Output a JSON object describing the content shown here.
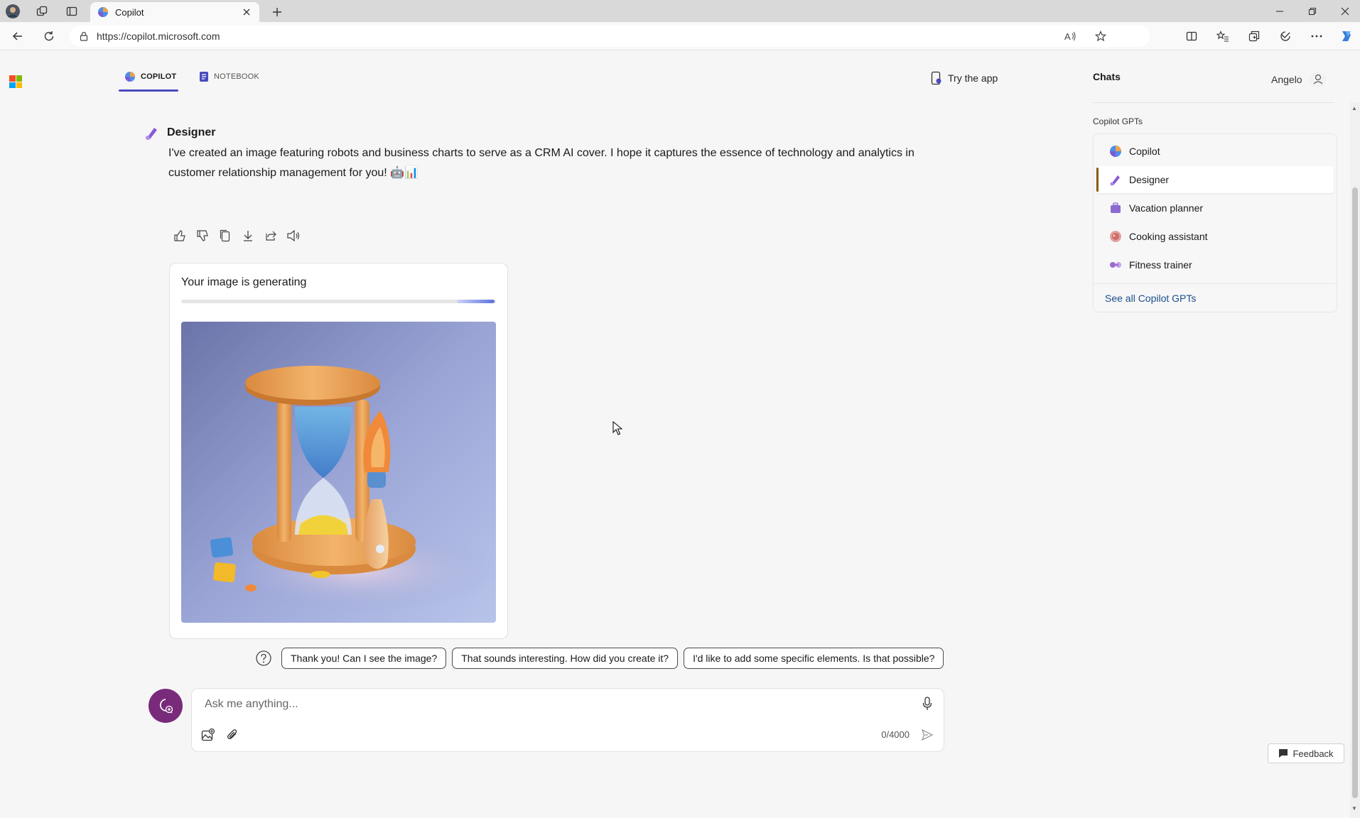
{
  "browser": {
    "tab_title": "Copilot",
    "url": "https://copilot.microsoft.com"
  },
  "nav": {
    "copilot_tab": "COPILOT",
    "notebook_tab": "NOTEBOOK",
    "try_app": "Try the app"
  },
  "message": {
    "author": "Designer",
    "text": "I've created an image featuring robots and business charts to serve as a CRM AI cover. I hope it captures the essence of technology and analytics in customer relationship management for you! 🤖📊"
  },
  "image_card": {
    "status": "Your image is generating",
    "progress": 0.12
  },
  "suggestions": [
    "Thank you! Can I see the image?",
    "That sounds interesting. How did you create it?",
    "I'd like to add some specific elements. Is that possible?"
  ],
  "composer": {
    "placeholder": "Ask me anything...",
    "counter": "0/4000"
  },
  "sidebar": {
    "title": "Chats",
    "user": "Angelo",
    "gpts_title": "Copilot GPTs",
    "gpts": [
      {
        "label": "Copilot",
        "icon": "copilot-icon",
        "color": "#4f8de8",
        "selected": false
      },
      {
        "label": "Designer",
        "icon": "designer-icon",
        "color": "#8a5ad8",
        "selected": true
      },
      {
        "label": "Vacation planner",
        "icon": "suitcase-icon",
        "color": "#8b6bd0",
        "selected": false
      },
      {
        "label": "Cooking assistant",
        "icon": "bowl-icon",
        "color": "#d06a6a",
        "selected": false
      },
      {
        "label": "Fitness trainer",
        "icon": "dumbbell-icon",
        "color": "#9a6ad0",
        "selected": false
      }
    ],
    "see_all": "See all Copilot GPTs"
  },
  "footer": {
    "feedback": "Feedback"
  },
  "colors": {
    "accent": "#4a4ac0",
    "newtopic": "#7a2a7a",
    "link": "#1a4f8a"
  }
}
